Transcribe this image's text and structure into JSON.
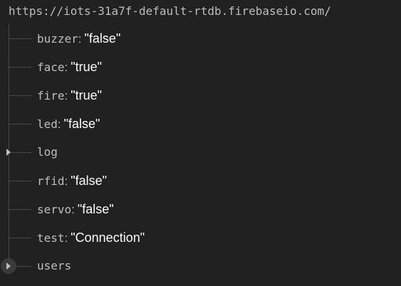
{
  "database": {
    "url": "https://iots-31a7f-default-rtdb.firebaseio.com/"
  },
  "nodes": [
    {
      "key": "buzzer",
      "separator": ":",
      "value": "\"false\""
    },
    {
      "key": "face",
      "separator": ":",
      "value": "\"true\""
    },
    {
      "key": "fire",
      "separator": ":",
      "value": "\"true\""
    },
    {
      "key": "led",
      "separator": ":",
      "value": "\"false\""
    },
    {
      "key": "log",
      "expandable": true,
      "expanded": false
    },
    {
      "key": "rfid",
      "separator": ":",
      "value": "\"false\""
    },
    {
      "key": "servo",
      "separator": ":",
      "value": "\"false\""
    },
    {
      "key": "test",
      "separator": ":",
      "value": "\"Connection\""
    },
    {
      "key": "users",
      "expandable": true,
      "expanded": false
    }
  ],
  "icons": {
    "expand": "caret-right-icon"
  },
  "colors": {
    "background": "#212121",
    "key_text": "#bdbdbd",
    "value_text": "#ffffff",
    "tree_line": "#4a4a4a"
  }
}
